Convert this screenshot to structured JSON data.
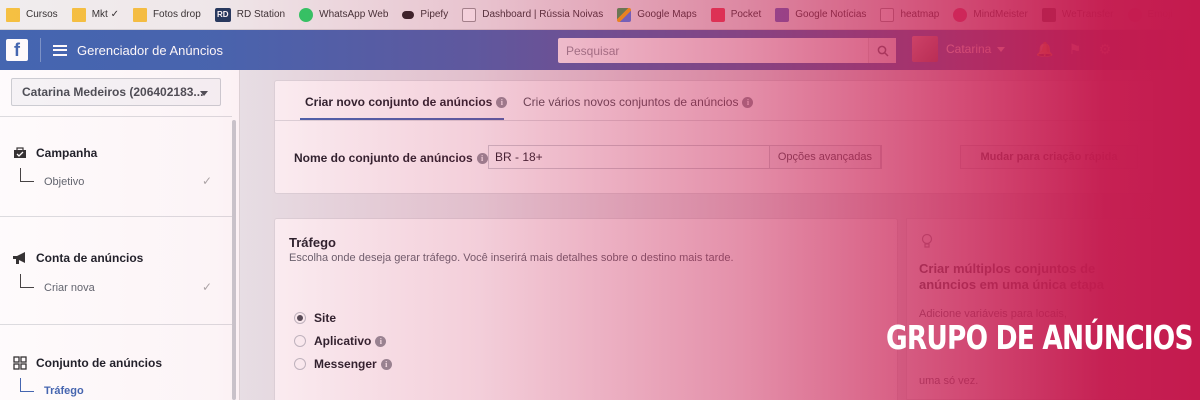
{
  "bookmarks": [
    {
      "label": "Cursos",
      "icon": "folder-icon"
    },
    {
      "label": "Mkt ✓",
      "icon": "folder-icon"
    },
    {
      "label": "Fotos drop",
      "icon": "folder-icon"
    },
    {
      "label": "RD Station",
      "icon": "rd-station-icon"
    },
    {
      "label": "WhatsApp Web",
      "icon": "whatsapp-icon"
    },
    {
      "label": "Pipefy",
      "icon": "pipefy-icon"
    },
    {
      "label": "Dashboard | Rússia Noivas",
      "icon": "document-icon"
    },
    {
      "label": "Google Maps",
      "icon": "maps-icon"
    },
    {
      "label": "Pocket",
      "icon": "pocket-icon"
    },
    {
      "label": "Google Notícias",
      "icon": "news-icon"
    },
    {
      "label": "heatmap",
      "icon": "document-icon"
    },
    {
      "label": "MindMeister",
      "icon": "mindmeister-icon"
    },
    {
      "label": "WeTransfer",
      "icon": "wetransfer-icon"
    },
    {
      "label": "Emoji",
      "icon": "emoji-icon"
    }
  ],
  "topbar": {
    "logo": "f",
    "title": "Gerenciador de Anúncios",
    "search_placeholder": "Pesquisar",
    "user_name": "Catarina"
  },
  "sidebar": {
    "account": "Catarina Medeiros (206402183...",
    "steps": [
      {
        "title": "Campanha",
        "sub": "Objetivo",
        "icon": "briefcase-icon",
        "done": true
      },
      {
        "title": "Conta de anúncios",
        "sub": "Criar nova",
        "icon": "megaphone-icon",
        "done": true
      },
      {
        "title": "Conjunto de anúncios",
        "sub": "Tráfego",
        "icon": "grid-icon",
        "done": false
      }
    ]
  },
  "main": {
    "tabs": [
      {
        "label": "Criar novo conjunto de anúncios",
        "active": true
      },
      {
        "label": "Crie vários novos conjuntos de anúncios",
        "active": false
      }
    ],
    "name_label": "Nome do conjunto de anúncios",
    "name_value": "BR - 18+",
    "advanced_options": "Opções avançadas",
    "quick_create": "Mudar para criação rápida",
    "section_title": "Tráfego",
    "section_desc": "Escolha onde deseja gerar tráfego. Você inserirá mais detalhes sobre o destino mais tarde.",
    "options": [
      {
        "label": "Site",
        "selected": true,
        "info": false
      },
      {
        "label": "Aplicativo",
        "selected": false,
        "info": true
      },
      {
        "label": "Messenger",
        "selected": false,
        "info": true
      }
    ]
  },
  "tip": {
    "title": "Criar múltiplos conjuntos de anúncios em uma única etapa",
    "body_line1": "Adicione variáveis para locais,",
    "body_line2": "uma só vez."
  },
  "banner": {
    "text": "GRUPO DE ANÚNCIOS"
  },
  "colors": {
    "facebook_blue": "#4267b2",
    "overlay_pink": "#c41a4e"
  }
}
